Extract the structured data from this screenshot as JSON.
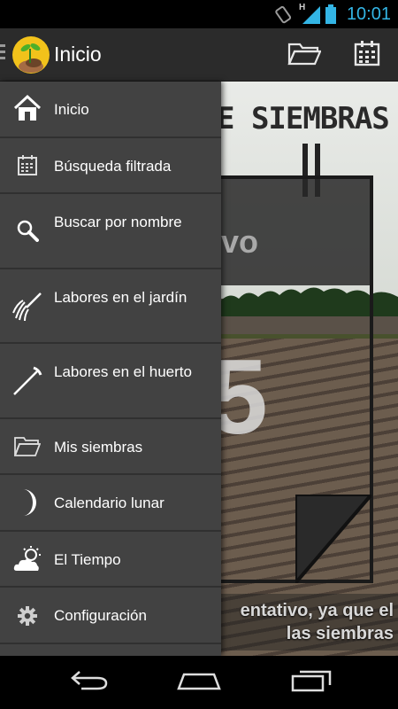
{
  "status_bar": {
    "time": "10:01",
    "network_label": "H",
    "icons": [
      "rotation-icon",
      "signal-icon",
      "battery-icon"
    ]
  },
  "action_bar": {
    "title": "Inicio",
    "actions": [
      "folder-icon",
      "calendar-icon"
    ]
  },
  "drawer": {
    "items": [
      {
        "label": "Inicio",
        "icon": "home-icon"
      },
      {
        "label": "Búsqueda filtrada",
        "icon": "calendar-grid-icon"
      },
      {
        "label": "Buscar por nombre",
        "icon": "search-icon"
      },
      {
        "label": "Labores en el jardín",
        "icon": "rake-icon"
      },
      {
        "label": "Labores en el huerto",
        "icon": "hoe-icon"
      },
      {
        "label": "Mis siembras",
        "icon": "folder-icon"
      },
      {
        "label": "Calendario lunar",
        "icon": "moon-icon"
      },
      {
        "label": "El Tiempo",
        "icon": "weather-icon"
      },
      {
        "label": "Configuración",
        "icon": "gear-icon"
      }
    ]
  },
  "background": {
    "title_fragment": "E SIEMBRAS",
    "box_fragment": "vo",
    "digit_fragment": "5",
    "footer_line1": "entativo, ya que el",
    "footer_line2": "las siembras"
  },
  "nav_bar": {
    "buttons": [
      "back-icon",
      "home-nav-icon",
      "recent-apps-icon"
    ]
  },
  "colors": {
    "accent": "#33b5e5",
    "drawer_bg": "#424242",
    "action_bar_bg": "#2b2b2b"
  }
}
